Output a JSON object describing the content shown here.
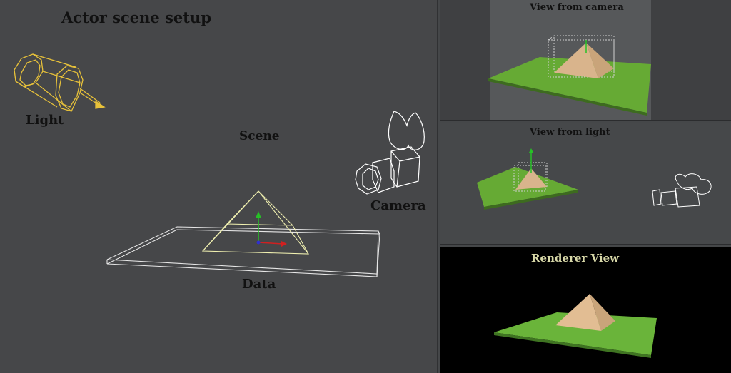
{
  "title": "Actor scene setup",
  "labels": {
    "light": "Light",
    "scene": "Scene",
    "camera": "Camera",
    "data": "Data"
  },
  "panels": {
    "view_from_camera": "View from camera",
    "view_from_light": "View from light",
    "renderer_view": "Renderer View"
  },
  "colors": {
    "light_wire": "#e8c23a",
    "scene_wire": "#ffffff",
    "pyramid_wire": "#f0f0b0",
    "ground": "#6ab43a",
    "pyramid_fill": "#d9b48c",
    "axis_green": "#26c126",
    "axis_red": "#d02020",
    "axis_blue": "#3030d0"
  }
}
